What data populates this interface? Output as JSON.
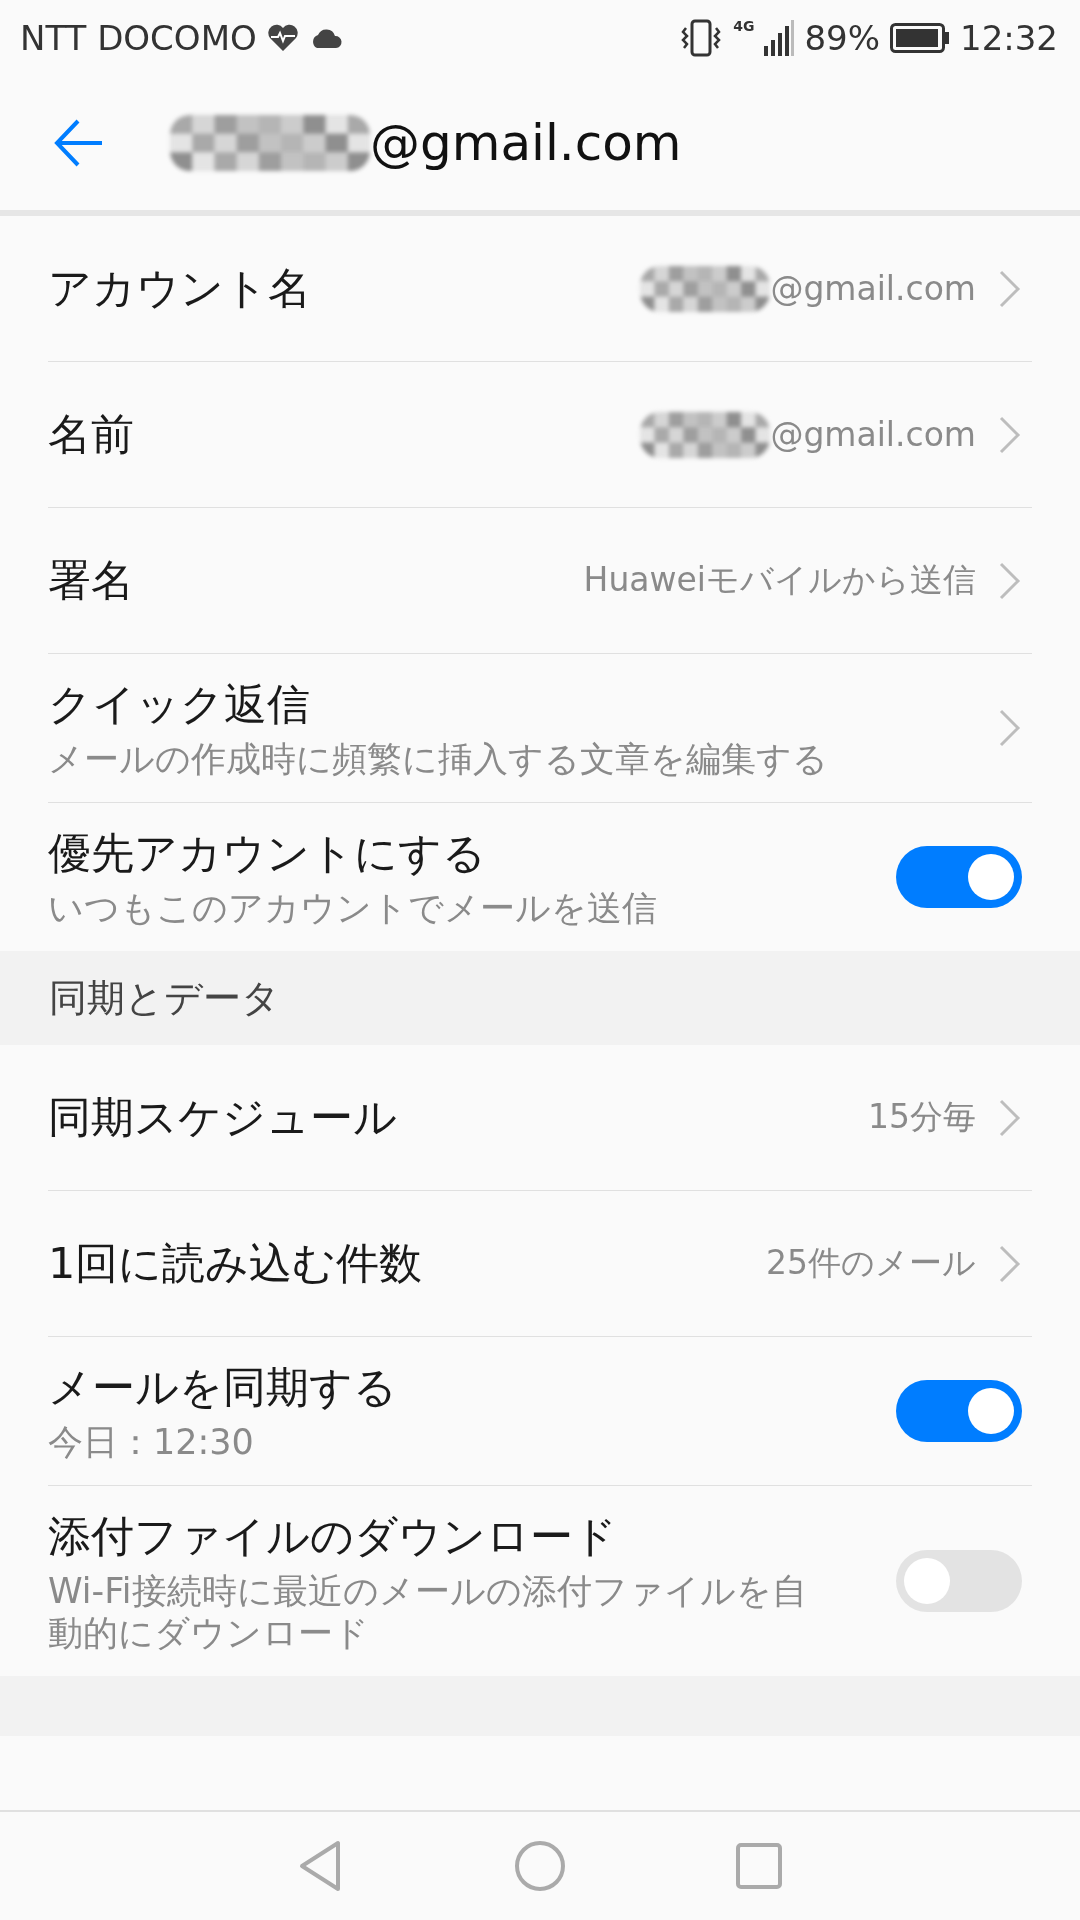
{
  "status_bar": {
    "carrier": "NTT DOCOMO",
    "network": "4G",
    "battery": "89%",
    "time": "12:32"
  },
  "header": {
    "title": "@gmail.com",
    "masked": true
  },
  "sections": [
    {
      "items": [
        {
          "kind": "nav",
          "title": "アカウント名",
          "value": "@gmail.com",
          "masked": true
        },
        {
          "kind": "nav",
          "title": "名前",
          "value": "@gmail.com",
          "masked": true
        },
        {
          "kind": "nav",
          "title": "署名",
          "value": "Huaweiモバイルから送信",
          "masked": false
        },
        {
          "kind": "nav",
          "title": "クイック返信",
          "subtitle": "メールの作成時に頻繁に挿入する文章を編集する"
        },
        {
          "kind": "toggle",
          "title": "優先アカウントにする",
          "subtitle": "いつもこのアカウントでメールを送信",
          "on": true
        }
      ]
    },
    {
      "header": "同期とデータ",
      "items": [
        {
          "kind": "nav",
          "title": "同期スケジュール",
          "value": "15分毎",
          "masked": false
        },
        {
          "kind": "nav",
          "title": "1回に読み込む件数",
          "value": "25件のメール",
          "masked": false
        },
        {
          "kind": "toggle",
          "title": "メールを同期する",
          "subtitle": "今日：12:30",
          "on": true
        },
        {
          "kind": "toggle",
          "title": "添付ファイルのダウンロード",
          "subtitle": "Wi-Fi接続時に最近のメールの添付ファイルを自動的にダウンロード",
          "on": false
        }
      ]
    }
  ]
}
